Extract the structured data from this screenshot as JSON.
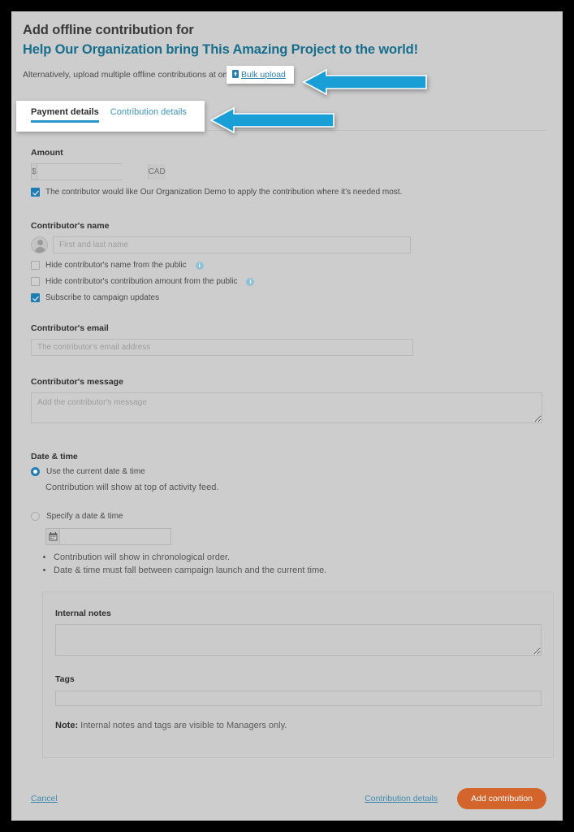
{
  "header": {
    "title_line1": "Add offline contribution for",
    "title_line2": "Help Our Organization bring This Amazing Project to the world!",
    "subtitle": "Alternatively, upload multiple offline contributions at once.",
    "bulk_upload_label": "Bulk upload",
    "bulk_upload_icon": "file-upload-icon",
    "title_accent_color": "#176e8c"
  },
  "tabs": [
    {
      "label": "Payment details",
      "active": true
    },
    {
      "label": "Contribution details",
      "active": false
    }
  ],
  "annotations": {
    "arrow_color": "#1a9ed6",
    "arrows": [
      {
        "name": "arrow-pointing-bulk-upload",
        "target": "Bulk upload"
      },
      {
        "name": "arrow-pointing-contribution-details-tab",
        "target": "Contribution details tab"
      }
    ]
  },
  "form": {
    "amount": {
      "label": "Amount",
      "prefix": "$",
      "suffix": "CAD",
      "value": "",
      "placeholder": ""
    },
    "apply_where_needed": {
      "label": "The contributor would like Our Organization Demo to apply the contribution where it's needed most.",
      "checked": true
    },
    "contributor_name": {
      "label": "Contributor's name",
      "value": "",
      "placeholder": "First and last name"
    },
    "privacy_options": [
      {
        "label": "Hide contributor's name from the public",
        "checked": false,
        "info": true
      },
      {
        "label": "Hide contributor's contribution amount from the public",
        "checked": false,
        "info": true
      },
      {
        "label": "Subscribe to campaign updates",
        "checked": true,
        "info": false
      }
    ],
    "contributor_email": {
      "label": "Contributor's email",
      "value": "",
      "placeholder": "The contributor's email address"
    },
    "contributor_message": {
      "label": "Contributor's message",
      "value": "",
      "placeholder": "Add the contributor's message"
    },
    "date_time": {
      "label": "Date & time",
      "option_current": "Use the current date & time",
      "option_current_selected": true,
      "current_helper": "Contribution will show at top of activity feed.",
      "option_specify": "Specify a date & time",
      "option_specify_selected": false,
      "date_value": "",
      "date_placeholder": "",
      "calendar_icon": "calendar-icon",
      "specify_bullets": [
        "Contribution will show in chronological order.",
        "Date & time must fall between campaign launch and the current time."
      ]
    },
    "internal": {
      "notes_label": "Internal notes",
      "notes_value": "",
      "tags_label": "Tags",
      "tags_value": "",
      "note_prefix": "Note:",
      "note_text": " Internal notes and tags are visible to Managers only."
    }
  },
  "footer": {
    "cancel_label": "Cancel",
    "contribution_details_label": "Contribution details",
    "submit_label": "Add contribution",
    "submit_color": "#d3642c"
  }
}
